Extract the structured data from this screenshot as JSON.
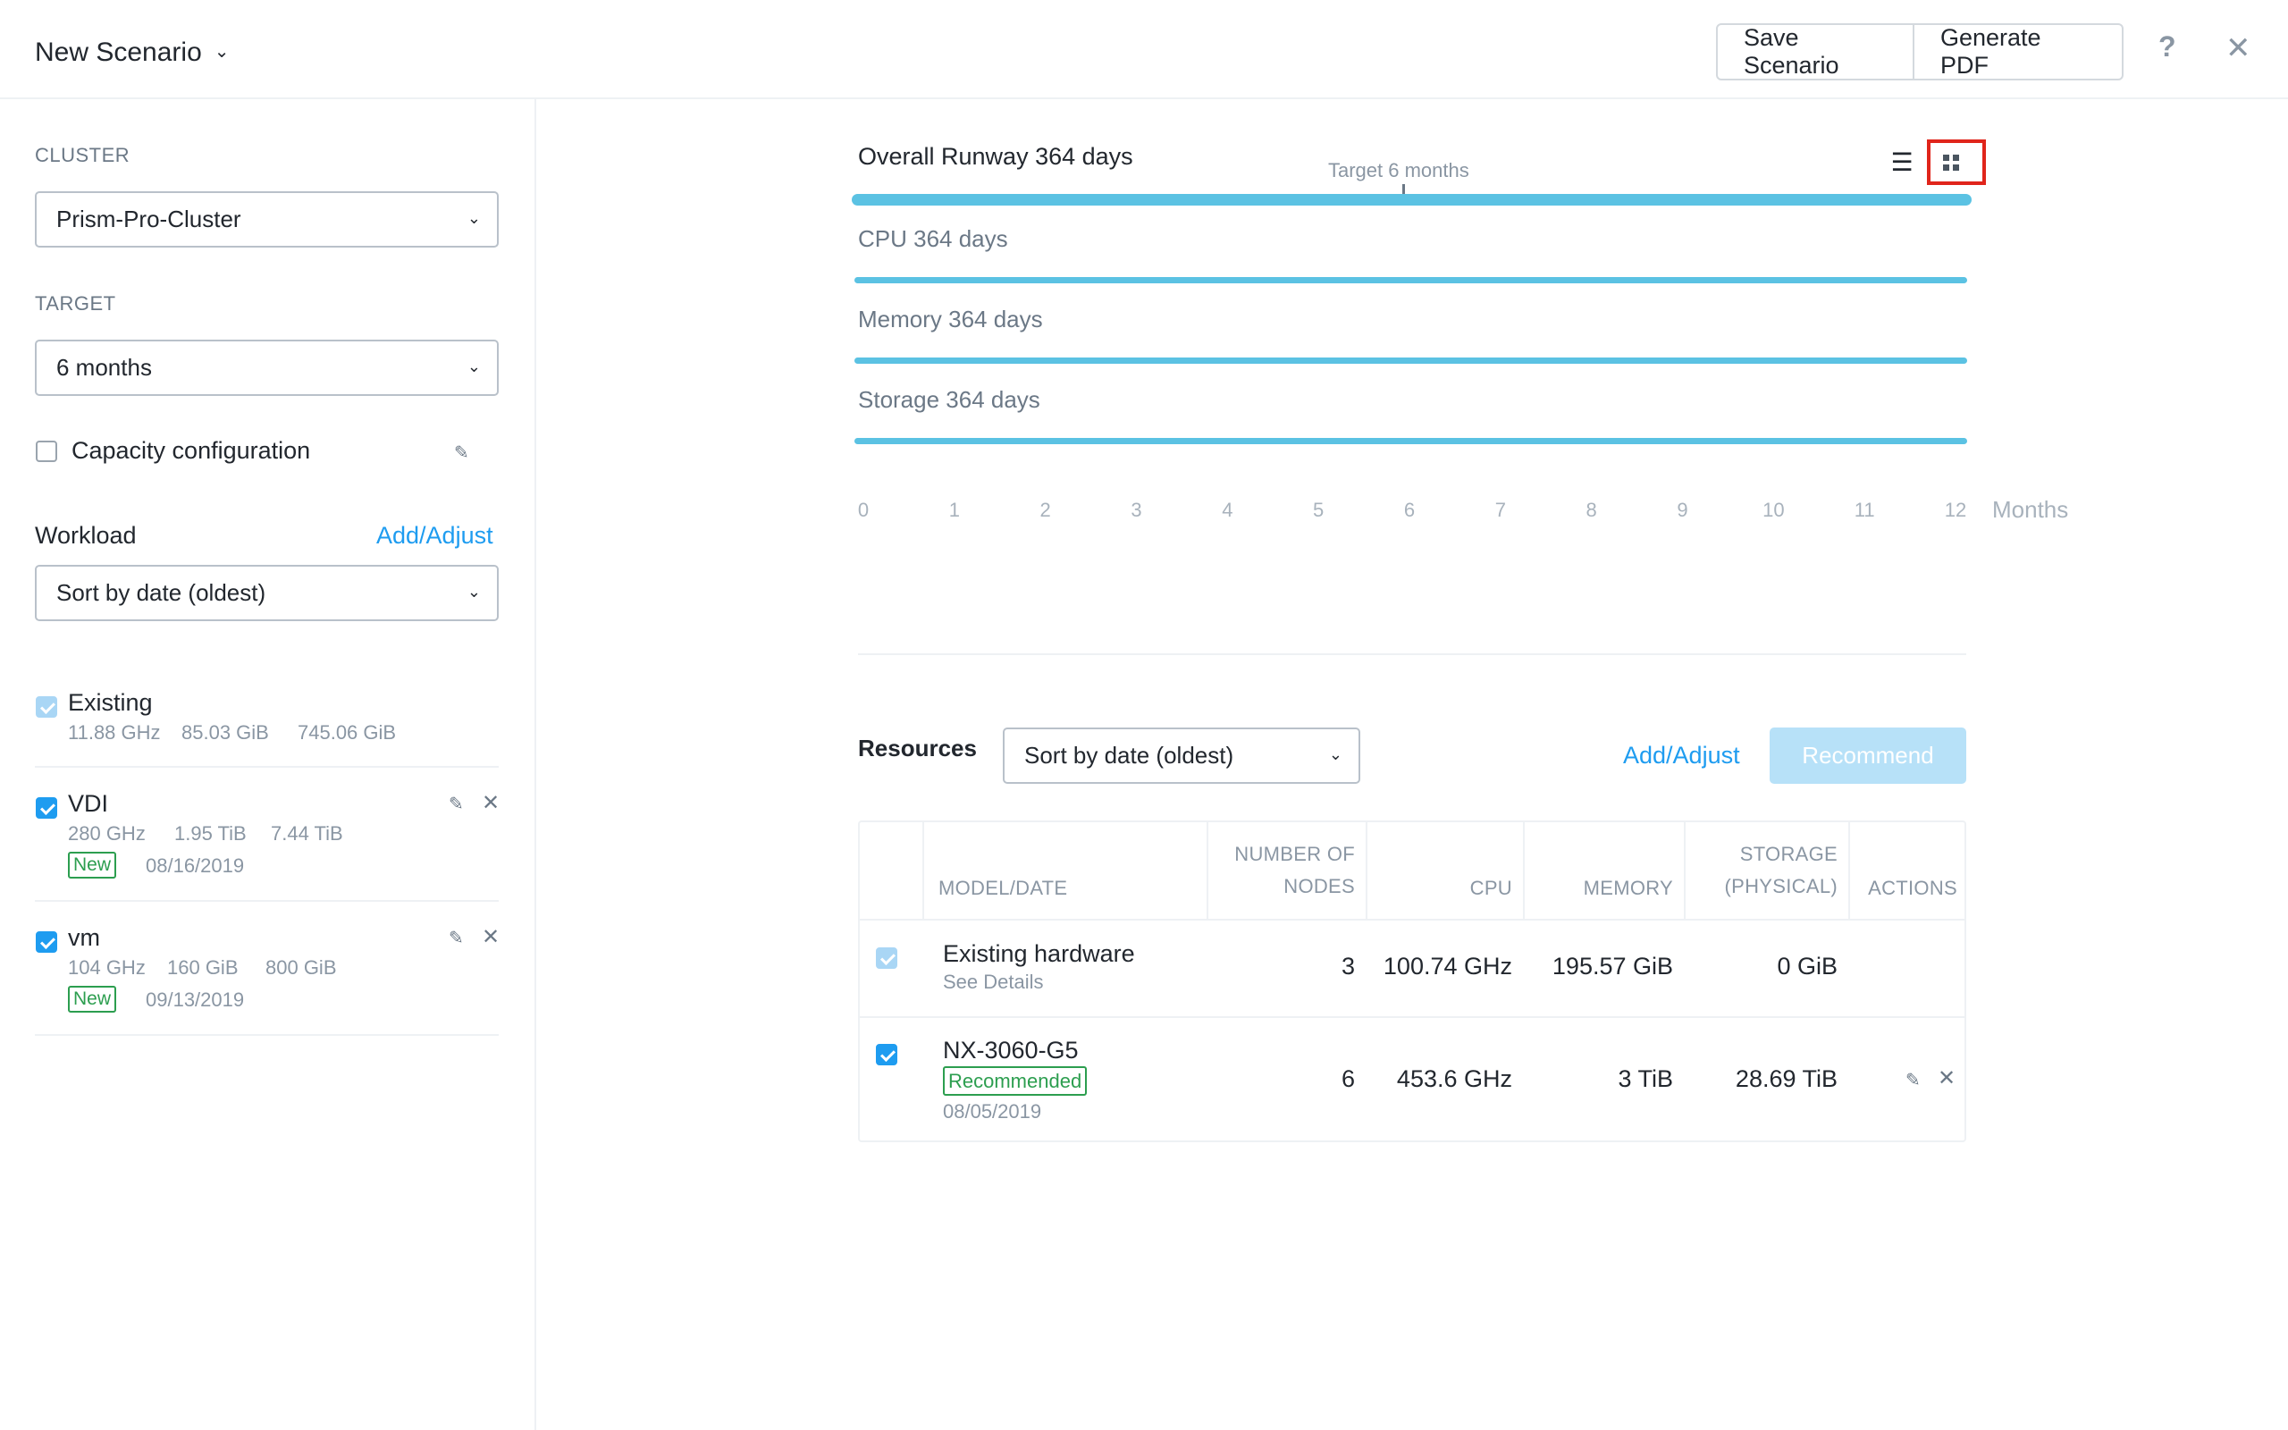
{
  "header": {
    "title": "New Scenario",
    "save_label": "Save Scenario",
    "pdf_label": "Generate PDF",
    "help_glyph": "?",
    "close_glyph": "✕"
  },
  "sidebar": {
    "cluster_label": "CLUSTER",
    "cluster_value": "Prism-Pro-Cluster",
    "target_label": "TARGET",
    "target_value": "6 months",
    "capacity_label": "Capacity configuration",
    "workload_label": "Workload",
    "workload_add": "Add/Adjust",
    "workload_sort": "Sort by date (oldest)",
    "workloads": [
      {
        "name": "Existing",
        "cpu": "11.88 GHz",
        "memory": "85.03 GiB",
        "storage": "745.06 GiB"
      },
      {
        "name": "VDI",
        "cpu": "280 GHz",
        "memory": "1.95 TiB",
        "storage": "7.44 TiB",
        "badge": "New",
        "date": "08/16/2019"
      },
      {
        "name": "vm",
        "cpu": "104 GHz",
        "memory": "160 GiB",
        "storage": "800 GiB",
        "badge": "New",
        "date": "09/13/2019"
      }
    ]
  },
  "runway": {
    "overall": "Overall Runway 364 days",
    "target_label": "Target 6 months",
    "cpu": "CPU 364 days",
    "memory": "Memory 364 days",
    "storage": "Storage 364 days",
    "ticks": [
      "0",
      "1",
      "2",
      "3",
      "4",
      "5",
      "6",
      "7",
      "8",
      "9",
      "10",
      "11",
      "12"
    ],
    "unit": "Months",
    "target_months": 6,
    "overall_days": 364,
    "max_months": 12
  },
  "resources": {
    "label": "Resources",
    "sort": "Sort by date (oldest)",
    "add": "Add/Adjust",
    "recommend": "Recommend",
    "columns": {
      "model": "MODEL/DATE",
      "nodes_1": "NUMBER OF",
      "nodes_2": "NODES",
      "cpu": "CPU",
      "memory": "MEMORY",
      "storage_1": "STORAGE",
      "storage_2": "(PHYSICAL)",
      "actions": "ACTIONS"
    },
    "rows": [
      {
        "model": "Existing hardware",
        "sub": "See Details",
        "nodes": "3",
        "cpu": "100.74 GHz",
        "memory": "195.57 GiB",
        "storage": "0 GiB"
      },
      {
        "model": "NX-3060-G5",
        "badge": "Recommended",
        "date": "08/05/2019",
        "nodes": "6",
        "cpu": "453.6 GHz",
        "memory": "3 TiB",
        "storage": "28.69 TiB"
      }
    ]
  },
  "icons": {
    "caret": "⌄",
    "pencil": "✎",
    "x": "✕",
    "list": "☰"
  },
  "colors": {
    "accent": "#1e9cf0",
    "runway_bar": "#5bc2e3",
    "new_badge": "#2c9e4f",
    "highlight": "#e0251b"
  }
}
